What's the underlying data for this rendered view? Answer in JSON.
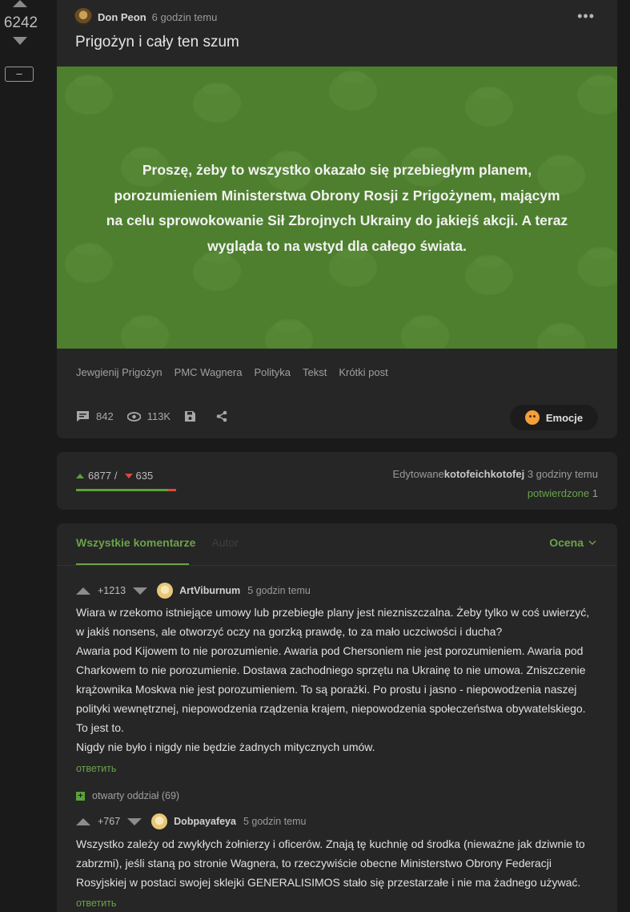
{
  "sidebar": {
    "vote_count": "6242",
    "collapse_label": "–"
  },
  "post": {
    "author": "Don Peon",
    "time": "6 godzin temu",
    "more_label": "•••",
    "title": "Prigożyn i cały ten szum",
    "banner_text": "Proszę, żeby to wszystko okazało się przebiegłym planem, porozumieniem Ministerstwa Obrony Rosji z Prigożynem, mającym na celu sprowokowanie Sił Zbrojnych Ukrainy do jakiejś akcji. A teraz wygląda to na wstyd dla całego świata.",
    "banner_color": "#4e7f2e",
    "tags": [
      "Jewgienij Prigożyn",
      "PMC Wagnera",
      "Polityka",
      "Tekst",
      "Krótki post"
    ],
    "comments_count": "842",
    "views": "113K",
    "emocje_label": "Emocje"
  },
  "rating": {
    "up": "6877",
    "separator": "/",
    "down": "635",
    "up_fraction": 0.916,
    "edited_prefix": "Edytowane",
    "edited_by": "kotofeichkotofej",
    "edited_time": "3 godziny temu",
    "confirmed_label": "potwierdzone",
    "confirmed_count": "1"
  },
  "comments_section": {
    "tab_all": "Wszystkie komentarze",
    "tab_author": "Autor",
    "sort_label": "Ocena",
    "comments": [
      {
        "score": "+1213",
        "author": "ArtViburnum",
        "time": "5 godzin temu",
        "lines": [
          "Wiara w rzekomo istniejące umowy lub przebiegłe plany jest niezniszczalna. Żeby tylko w coś uwierzyć, w jakiś nonsens, ale otworzyć oczy na gorzką prawdę, to za mało uczciwości i ducha?",
          "Awaria pod Kijowem to nie porozumienie. Awaria pod Chersoniem nie jest porozumieniem. Awaria pod Charkowem to nie porozumienie. Dostawa zachodniego sprzętu na Ukrainę to nie umowa. Zniszczenie krążownika Moskwa nie jest porozumieniem. To są porażki. Po prostu i jasno - niepowodzenia naszej polityki wewnętrznej, niepowodzenia rządzenia krajem, niepowodzenia społeczeństwa obywatelskiego.",
          "To jest to.",
          "Nigdy nie było i nigdy nie będzie żadnych mitycznych umów."
        ],
        "reply_label": "ответить",
        "thread_label": "otwarty oddział (69)"
      },
      {
        "score": "+767",
        "author": "Dobpayafeya",
        "time": "5 godzin temu",
        "lines": [
          "Wszystko zależy od zwykłych żołnierzy i oficerów. Znają tę kuchnię od środka (nieważne jak dziwnie to zabrzmi), jeśli staną po stronie Wagnera, to rzeczywiście obecne Ministerstwo Obrony Federacji Rosyjskiej w postaci swojej sklejki GENERALISIMOS stało się przestarzałe i nie ma żadnego używać."
        ],
        "reply_label": "ответить"
      }
    ]
  },
  "colors": {
    "accent_green": "#6aa34a",
    "down_red": "#e0463c",
    "card_bg": "#262626",
    "page_bg": "#1a1a1a"
  }
}
